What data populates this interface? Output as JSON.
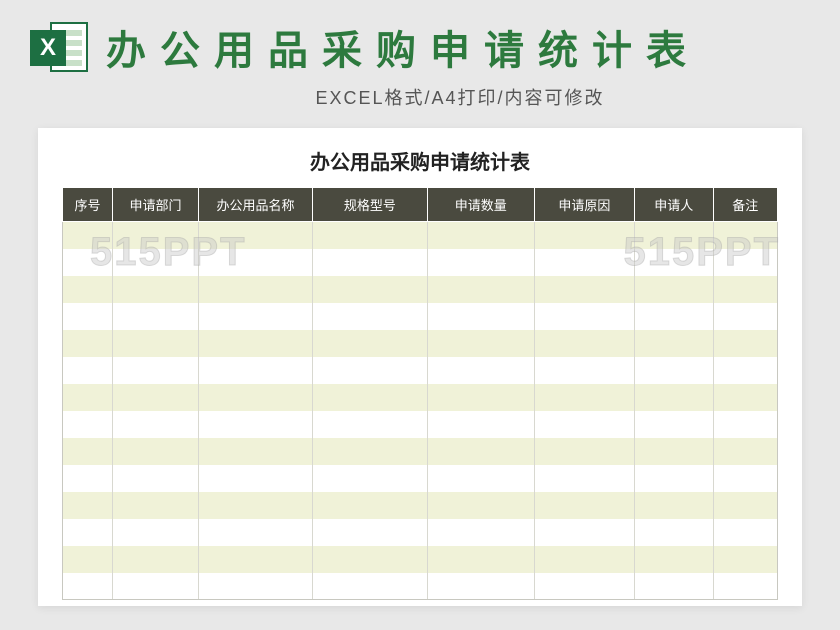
{
  "header": {
    "icon_letter": "X",
    "title": "办公用品采购申请统计表",
    "subtitle": "EXCEL格式/A4打印/内容可修改"
  },
  "sheet": {
    "title": "办公用品采购申请统计表",
    "columns": [
      "序号",
      "申请部门",
      "办公用品名称",
      "规格型号",
      "申请数量",
      "申请原因",
      "申请人",
      "备注"
    ],
    "row_count": 14
  },
  "watermark": "515PPT"
}
